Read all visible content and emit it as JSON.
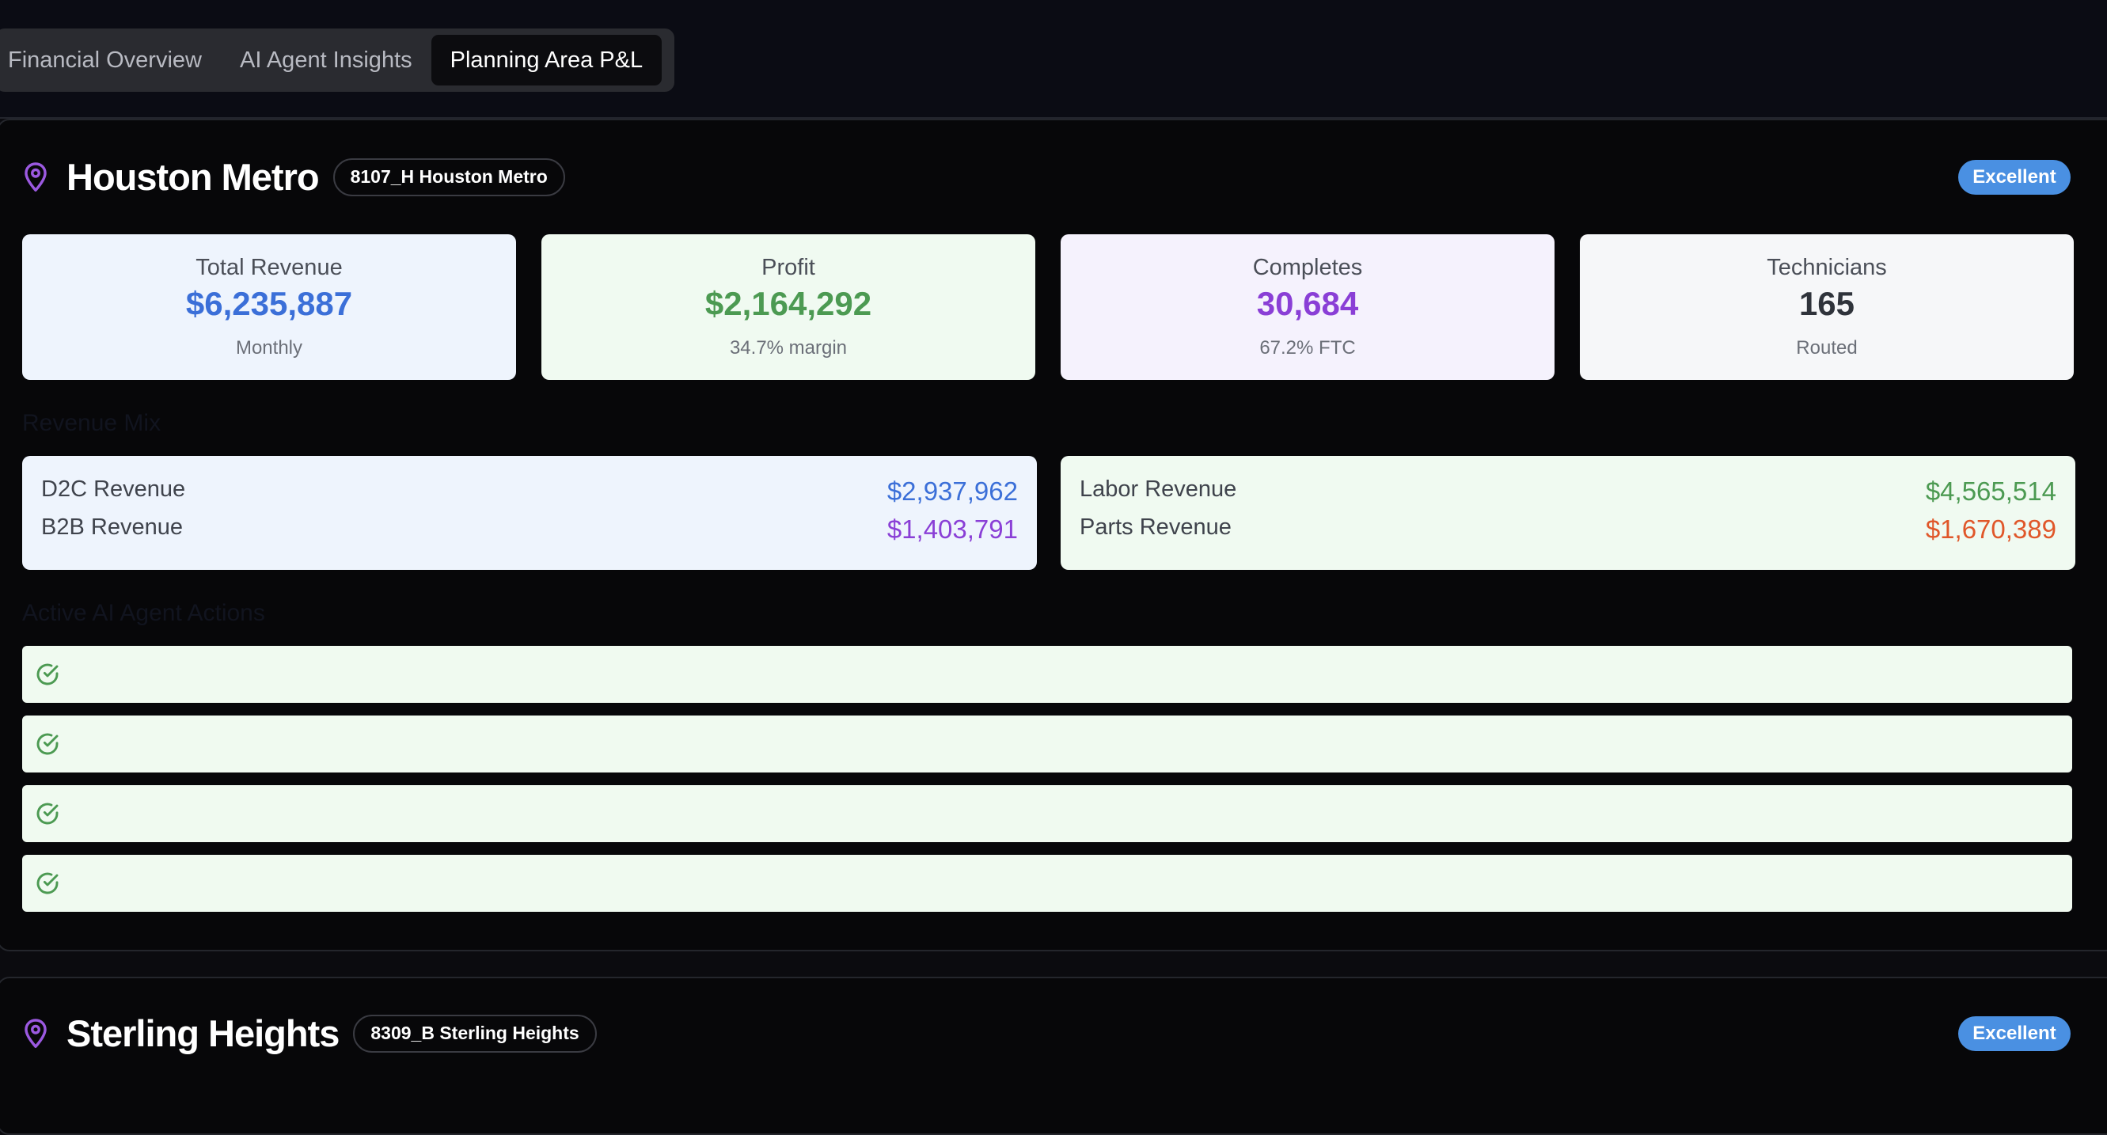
{
  "tabs": [
    {
      "label": "Financial Overview",
      "active": false
    },
    {
      "label": "AI Agent Insights",
      "active": false
    },
    {
      "label": "Planning Area P&L",
      "active": true
    }
  ],
  "areas": [
    {
      "name": "Houston Metro",
      "code": "8107_H Houston Metro",
      "status": "Excellent",
      "kpis": {
        "revenue": {
          "label": "Total Revenue",
          "value": "$6,235,887",
          "sub": "Monthly"
        },
        "profit": {
          "label": "Profit",
          "value": "$2,164,292",
          "sub": "34.7% margin"
        },
        "completes": {
          "label": "Completes",
          "value": "30,684",
          "sub": "67.2% FTC"
        },
        "technicians": {
          "label": "Technicians",
          "value": "165",
          "sub": "Routed"
        }
      },
      "revenue_mix_title": "Revenue Mix",
      "revenue_mix": {
        "d2c": {
          "label": "D2C Revenue",
          "value": "$2,937,962"
        },
        "b2b": {
          "label": "B2B Revenue",
          "value": "$1,403,791"
        },
        "labor": {
          "label": "Labor Revenue",
          "value": "$4,565,514"
        },
        "parts": {
          "label": "Parts Revenue",
          "value": "$1,670,389"
        }
      },
      "actions_title": "Active AI Agent Actions",
      "actions_count": 4
    },
    {
      "name": "Sterling Heights",
      "code": "8309_B Sterling Heights",
      "status": "Excellent"
    }
  ],
  "colors": {
    "blue": "#3b6fd8",
    "green": "#4c9a52",
    "purple": "#8a3fd6",
    "orange": "#e0572a",
    "badge": "#4a90e2",
    "pin": "#9b59e0"
  },
  "icons": {
    "pin": "map-pin-icon",
    "check": "check-circle-icon"
  }
}
